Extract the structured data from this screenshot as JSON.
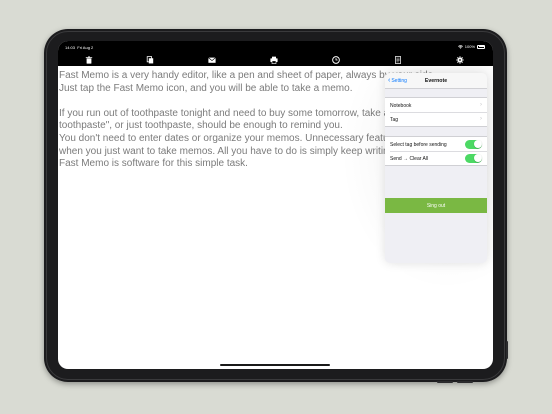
{
  "status_bar": {
    "time": "14:03",
    "date": "Fri Aug 2",
    "wifi_icon": "wifi-icon",
    "battery_percent": "100%"
  },
  "toolbar": {
    "icons": [
      "trash-icon",
      "copy-icon",
      "mail-icon",
      "print-icon",
      "clock-icon",
      "document-icon",
      "gear-icon"
    ]
  },
  "memo": {
    "text": "Fast Memo is a very handy editor, like a pen and sheet of paper, always by your side.\nJust tap the Fast Memo icon, and you will be able to take a memo.\n\nIf you run out of toothpaste tonight and need to buy some tomorrow, take a memo. \"Buy toothpaste\", or just toothpaste, should be enough to remind you.\nYou don't need to enter dates or organize your memos. Unnecessary features can be a nuisance when you just want to take memos. All you have to do is simply keep writing, and scroll down.\nFast Memo is software for this simple task."
  },
  "popover": {
    "back_label": "Setting",
    "title": "Evernote",
    "rows": [
      {
        "label": "Notebook"
      },
      {
        "label": "Tag"
      }
    ],
    "toggles": [
      {
        "label": "Select tag before sending",
        "on": true
      },
      {
        "label": "Send → Clear All",
        "on": true
      }
    ],
    "sign_out_label": "Sing out",
    "accent_color": "#0a7aff",
    "toggle_color": "#4cd964",
    "sign_out_color": "#7ab843"
  }
}
